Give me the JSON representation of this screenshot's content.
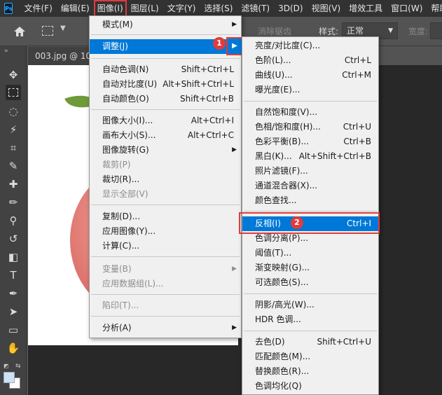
{
  "app": {
    "logo_text": "Ps"
  },
  "menubar": {
    "items": [
      "文件(F)",
      "编辑(E)",
      "图像(I)",
      "图层(L)",
      "文字(Y)",
      "选择(S)",
      "滤镜(T)",
      "3D(D)",
      "视图(V)",
      "增效工具",
      "窗口(W)",
      "帮助(H)"
    ],
    "active_index": 2
  },
  "options_bar": {
    "home_icon": "home-icon",
    "antialias_label": "消除锯齿",
    "style_label": "样式:",
    "style_value": "正常",
    "width_label": "宽度:"
  },
  "document": {
    "tab_title": "003.jpg @ 10"
  },
  "image_menu": {
    "items": [
      {
        "label": "模式(M)",
        "shortcut": "",
        "submenu": true,
        "disabled": false
      },
      {
        "label": "调整(J)",
        "shortcut": "",
        "submenu": true,
        "disabled": false,
        "highlighted": true
      },
      {
        "label": "自动色调(N)",
        "shortcut": "Shift+Ctrl+L",
        "disabled": false
      },
      {
        "label": "自动对比度(U)",
        "shortcut": "Alt+Shift+Ctrl+L",
        "disabled": false
      },
      {
        "label": "自动颜色(O)",
        "shortcut": "Shift+Ctrl+B",
        "disabled": false
      },
      {
        "label": "图像大小(I)...",
        "shortcut": "Alt+Ctrl+I",
        "disabled": false
      },
      {
        "label": "画布大小(S)...",
        "shortcut": "Alt+Ctrl+C",
        "disabled": false
      },
      {
        "label": "图像旋转(G)",
        "shortcut": "",
        "submenu": true,
        "disabled": false
      },
      {
        "label": "裁剪(P)",
        "shortcut": "",
        "disabled": true
      },
      {
        "label": "裁切(R)...",
        "shortcut": "",
        "disabled": false
      },
      {
        "label": "显示全部(V)",
        "shortcut": "",
        "disabled": true
      },
      {
        "label": "复制(D)...",
        "shortcut": "",
        "disabled": false
      },
      {
        "label": "应用图像(Y)...",
        "shortcut": "",
        "disabled": false
      },
      {
        "label": "计算(C)...",
        "shortcut": "",
        "disabled": false
      },
      {
        "label": "变量(B)",
        "shortcut": "",
        "submenu": true,
        "disabled": true
      },
      {
        "label": "应用数据组(L)...",
        "shortcut": "",
        "disabled": true
      },
      {
        "label": "陷印(T)...",
        "shortcut": "",
        "disabled": true
      },
      {
        "label": "分析(A)",
        "shortcut": "",
        "submenu": true,
        "disabled": false
      }
    ]
  },
  "adjust_menu": {
    "items": [
      {
        "label": "亮度/对比度(C)...",
        "shortcut": ""
      },
      {
        "label": "色阶(L)...",
        "shortcut": "Ctrl+L"
      },
      {
        "label": "曲线(U)...",
        "shortcut": "Ctrl+M"
      },
      {
        "label": "曝光度(E)...",
        "shortcut": ""
      },
      {
        "label": "自然饱和度(V)...",
        "shortcut": ""
      },
      {
        "label": "色相/饱和度(H)...",
        "shortcut": "Ctrl+U"
      },
      {
        "label": "色彩平衡(B)...",
        "shortcut": "Ctrl+B"
      },
      {
        "label": "黑白(K)...",
        "shortcut": "Alt+Shift+Ctrl+B"
      },
      {
        "label": "照片滤镜(F)...",
        "shortcut": ""
      },
      {
        "label": "通道混合器(X)...",
        "shortcut": ""
      },
      {
        "label": "颜色查找...",
        "shortcut": ""
      },
      {
        "label": "反相(I)",
        "shortcut": "Ctrl+I",
        "highlighted": true
      },
      {
        "label": "色调分离(P)...",
        "shortcut": ""
      },
      {
        "label": "阈值(T)...",
        "shortcut": ""
      },
      {
        "label": "渐变映射(G)...",
        "shortcut": ""
      },
      {
        "label": "可选颜色(S)...",
        "shortcut": ""
      },
      {
        "label": "阴影/高光(W)...",
        "shortcut": ""
      },
      {
        "label": "HDR 色调...",
        "shortcut": ""
      },
      {
        "label": "去色(D)",
        "shortcut": "Shift+Ctrl+U"
      },
      {
        "label": "匹配颜色(M)...",
        "shortcut": ""
      },
      {
        "label": "替换颜色(R)...",
        "shortcut": ""
      },
      {
        "label": "色调均化(Q)",
        "shortcut": ""
      }
    ]
  },
  "annotations": {
    "badge_1": "1",
    "badge_2": "2",
    "color": "#e03c3c"
  },
  "colors": {
    "highlight": "#0078d7",
    "menu_bg": "#f0f0f0",
    "app_bg": "#535353",
    "menubar_bg": "#323232"
  }
}
